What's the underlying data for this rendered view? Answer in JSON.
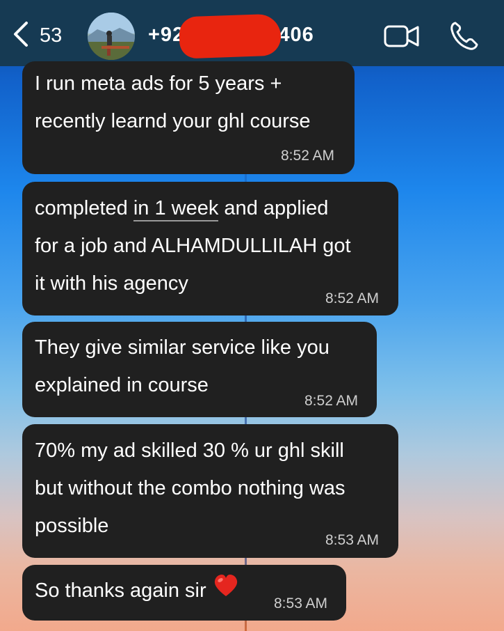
{
  "header": {
    "unread_count": "53",
    "phone_prefix": "+92",
    "phone_suffix": "5406",
    "video_icon": "video-camera-icon",
    "call_icon": "phone-icon"
  },
  "messages": [
    {
      "lines": [
        "I run meta ads for 5 years +",
        "recently learnd your ghl course"
      ],
      "time": "8:52 AM"
    },
    {
      "line1_before": "completed ",
      "line1_under": "in 1 week",
      "line1_after": " and applied",
      "lines_rest": [
        "for a job and ALHAMDULLILAH got",
        "it with his agency"
      ],
      "time": "8:52 AM"
    },
    {
      "lines": [
        "They give similar service like you",
        "explained in course"
      ],
      "time": "8:52 AM"
    },
    {
      "lines": [
        "70% my ad skilled 30 % ur ghl skill",
        "but without the combo nothing was",
        "possible"
      ],
      "time": "8:53 AM"
    },
    {
      "lines": [
        "So thanks again sir"
      ],
      "emoji": "red-heart-icon",
      "time": "8:53 AM"
    }
  ]
}
